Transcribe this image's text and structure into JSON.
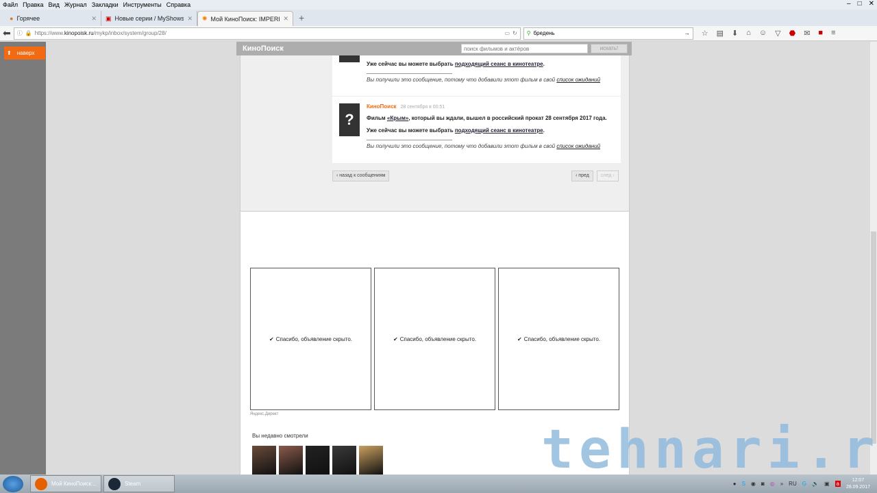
{
  "menu": [
    "Файл",
    "Правка",
    "Вид",
    "Журнал",
    "Закладки",
    "Инструменты",
    "Справка"
  ],
  "tabs": [
    {
      "title": "Горячее"
    },
    {
      "title": "Новые серии / MyShows..."
    },
    {
      "title": "Мой КиноПоиск: IMPERIA..."
    }
  ],
  "url": {
    "prefix": "https://www.",
    "domain": "kinopoisk.ru",
    "path": "/mykp/inbox/system/group/28/"
  },
  "search": {
    "value": "бредень"
  },
  "sidebar": {
    "up_label": "наверх"
  },
  "site": {
    "logo": "КиноПоиск",
    "search_placeholder": "поиск фильмов и актёров",
    "search_button": "искать!"
  },
  "messages": [
    {
      "line2_prefix": "Уже сейчас вы можете выбрать ",
      "line2_link": "подходящий сеанс в кинотеатре",
      "note_prefix": "Вы получили это сообщение, потому что добавили этот фильм в свой ",
      "note_link": "список ожиданий"
    },
    {
      "avatar": "?",
      "from": "КиноПоиск",
      "date": "28 сентября в 00:51",
      "line1_prefix": "Фильм ",
      "line1_link": "«Крым»",
      "line1_suffix": ", который вы ждали, вышел в российский прокат 28 сентября 2017 года.",
      "line2_prefix": "Уже сейчас вы можете выбрать ",
      "line2_link": "подходящий сеанс в кинотеатре",
      "note_prefix": "Вы получили это сообщение, потому что добавили этот фильм в свой ",
      "note_link": "список ожиданий"
    }
  ],
  "pager": {
    "back": "‹ назад к сообщениям",
    "prev": "‹ пред",
    "next": "след ›"
  },
  "ads": {
    "hidden_text": "Спасибо, объявление скрыто.",
    "label": "Яндекс.Директ"
  },
  "recent": {
    "title": "Вы недавно смотрели",
    "posters": [
      "#6a4a3a",
      "#8a5a4a",
      "#222222",
      "#3a3a3a",
      "#c9a060"
    ]
  },
  "watermark": "tehnari.ru",
  "taskbar": {
    "tasks": [
      "Мой КиноПоиск:...",
      "Steam"
    ],
    "lang": "RU",
    "time": "12:07",
    "date": "28.09.2017"
  }
}
